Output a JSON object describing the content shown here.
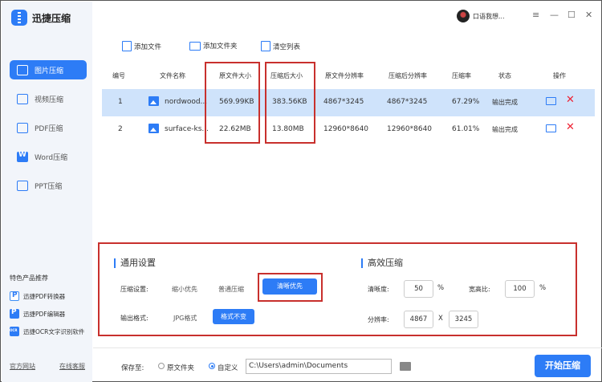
{
  "app": {
    "title": "迅捷压缩",
    "user_name": "口语我想..."
  },
  "window_controls": {
    "menu": "≡",
    "minimize": "—",
    "maximize": "☐",
    "close": "✕"
  },
  "sidebar": {
    "items": [
      {
        "label": "图片压缩",
        "active": true
      },
      {
        "label": "视频压缩"
      },
      {
        "label": "PDF压缩"
      },
      {
        "label": "Word压缩"
      },
      {
        "label": "PPT压缩"
      }
    ],
    "promo_title": "特色产品推荐",
    "promos": [
      "迅捷PDF转换器",
      "迅捷PDF编辑器",
      "迅捷OCR文字识别软件"
    ],
    "footer": {
      "website": "官方网站",
      "support": "在线客服"
    }
  },
  "toolbar": {
    "add_file": "添加文件",
    "add_folder": "添加文件夹",
    "clear_list": "清空列表"
  },
  "table": {
    "headers": [
      "编号",
      "文件名称",
      "原文件大小",
      "压缩后大小",
      "原文件分辨率",
      "压缩后分辨率",
      "压缩率",
      "状态",
      "操作"
    ],
    "rows": [
      {
        "no": "1",
        "name": "nordwood...",
        "orig_size": "569.99KB",
        "comp_size": "383.56KB",
        "orig_res": "4867*3245",
        "comp_res": "4867*3245",
        "ratio": "67.29%",
        "status": "输出完成"
      },
      {
        "no": "2",
        "name": "surface-ks...",
        "orig_size": "22.62MB",
        "comp_size": "13.80MB",
        "orig_res": "12960*8640",
        "comp_res": "12960*8640",
        "ratio": "61.01%",
        "status": "输出完成"
      }
    ]
  },
  "settings": {
    "general_title": "通用设置",
    "compress_label": "压缩设置:",
    "compress_options": [
      "缩小优先",
      "普通压缩",
      "清晰优先"
    ],
    "compress_selected": "清晰优先",
    "format_label": "输出格式:",
    "format_options": [
      "JPG格式",
      "格式不变"
    ],
    "format_selected": "格式不变",
    "efficient_title": "高效压缩",
    "clarity_label": "清晰度:",
    "clarity_value": "50",
    "clarity_unit": "%",
    "aspect_label": "宽高比:",
    "aspect_value": "100",
    "aspect_unit": "%",
    "resolution_label": "分辨率:",
    "res_width": "4867",
    "res_sep": "X",
    "res_height": "3245"
  },
  "bottom": {
    "save_to": "保存至:",
    "opt_original": "原文件夹",
    "opt_custom": "自定义",
    "custom_selected": true,
    "path": "C:\\Users\\admin\\Documents",
    "start_button": "开始压缩"
  },
  "colors": {
    "accent": "#2d7cf6",
    "highlight_border": "#c8302d",
    "selected_row": "#cfe3fb"
  }
}
